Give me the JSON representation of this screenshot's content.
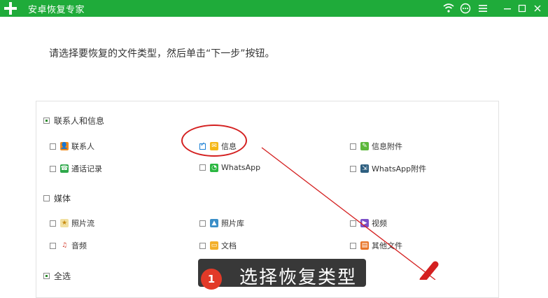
{
  "app": {
    "title": "安卓恢复专家"
  },
  "prompt": "请选择要恢复的文件类型，然后单击“下一步”按钮。",
  "categories": [
    {
      "label": "联系人和信息",
      "items": [
        "联系人",
        "信息",
        "信息附件",
        "通话记录",
        "WhatsApp",
        "WhatsApp附件"
      ]
    },
    {
      "label": "媒体",
      "items": [
        "照片流",
        "照片库",
        "视频",
        "音频",
        "文档",
        "其他文件"
      ]
    },
    {
      "label": "全选"
    }
  ],
  "annotation": {
    "step_number": "1",
    "text": "选择恢复类型"
  },
  "colors": {
    "titlebar": "#1fab3a",
    "annotation_red": "#d42020",
    "tooltip_bg": "#383838"
  }
}
